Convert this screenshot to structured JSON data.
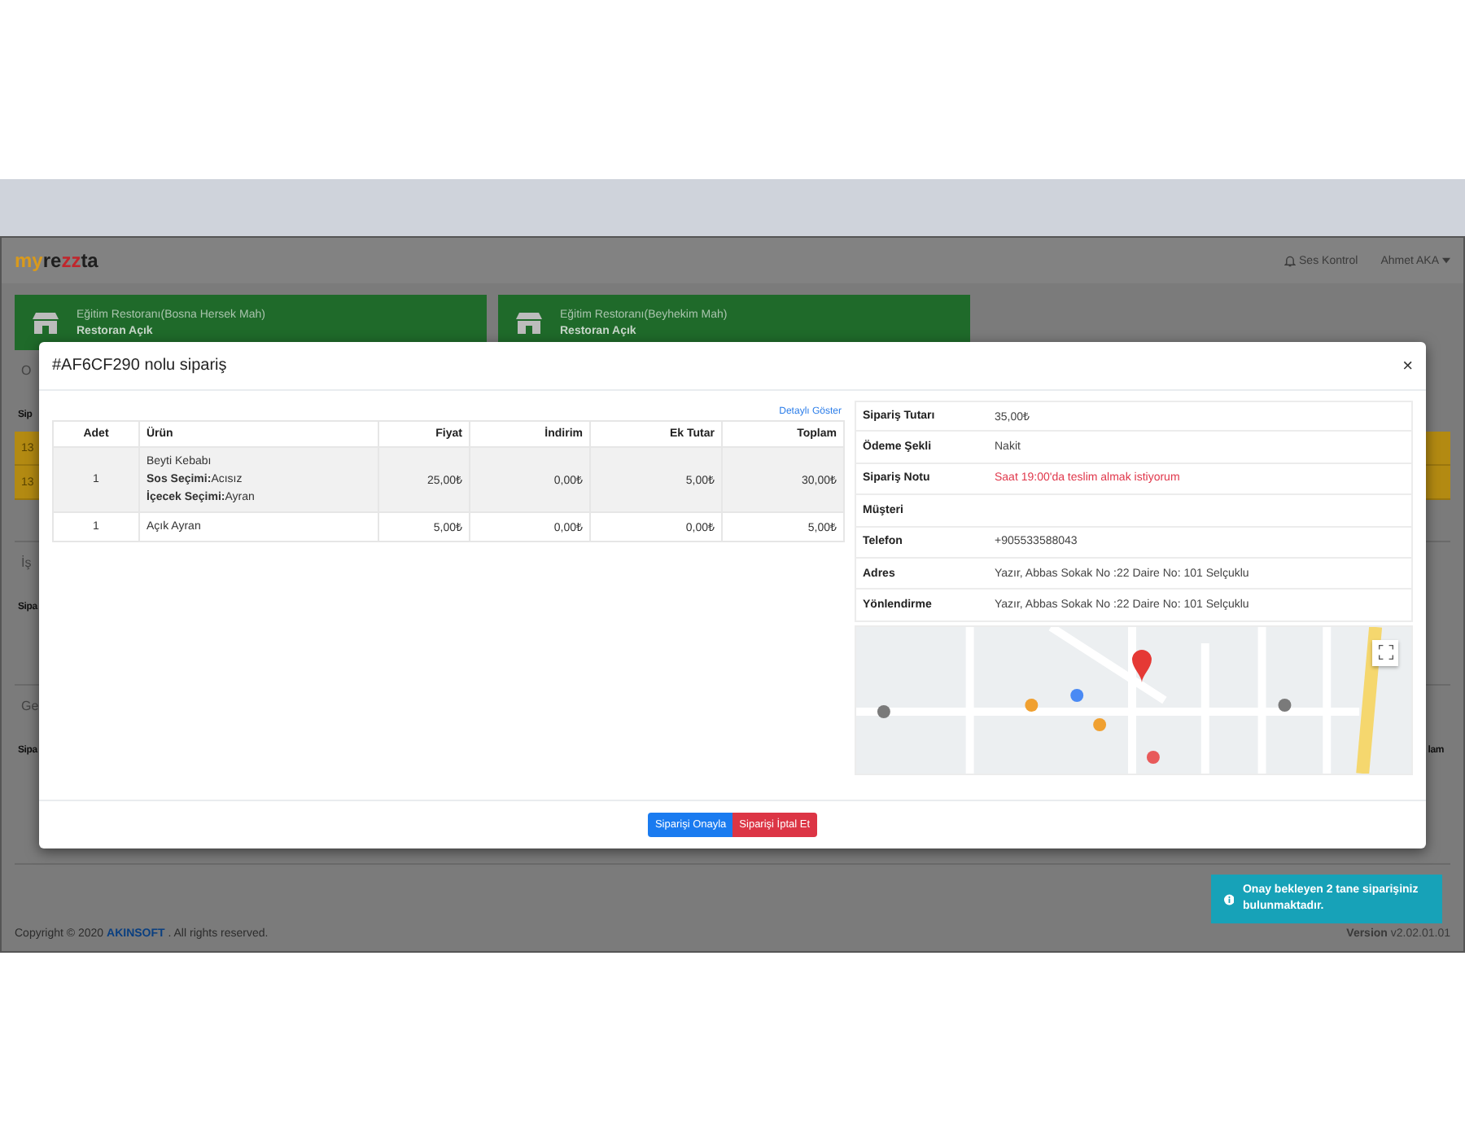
{
  "navbar": {
    "logo": [
      {
        "text": "my",
        "color": "#d99a1c"
      },
      {
        "text": "re",
        "color": "#1e1e1e"
      },
      {
        "text": "zz",
        "color": "#c0262c"
      },
      {
        "text": "ta",
        "color": "#1e1e1e"
      }
    ],
    "sound": "Ses Kontrol",
    "user": "Ahmet AKA"
  },
  "restaurants": [
    {
      "name": "Eğitim Restoranı(Bosna Hersek Mah)",
      "status": "Restoran Açık"
    },
    {
      "name": "Eğitim Restoranı(Beyhekim Mah)",
      "status": "Restoran Açık"
    }
  ],
  "background_sections": [
    {
      "tab": "O",
      "header": "Sip",
      "rows": [
        "13",
        "13"
      ]
    },
    {
      "tab": "İş",
      "header": "Sipa"
    },
    {
      "tab": "Ge",
      "header": "Sipa",
      "header_right": "lam"
    }
  ],
  "modal": {
    "title": "#AF6CF290 nolu sipariş",
    "close": "×",
    "detail_link": "Detaylı Göster",
    "columns": [
      "Adet",
      "Ürün",
      "Fiyat",
      "İndirim",
      "Ek Tutar",
      "Toplam"
    ],
    "rows": [
      {
        "qty": "1",
        "product": [
          "Beyti Kebabı",
          "**Sos Seçimi:**Acısız",
          "**İçecek Seçimi:**Ayran"
        ],
        "price": "25,00₺",
        "discount": "0,00₺",
        "extra": "5,00₺",
        "total": "30,00₺"
      },
      {
        "qty": "1",
        "product": [
          "Açık Ayran"
        ],
        "price": "5,00₺",
        "discount": "0,00₺",
        "extra": "0,00₺",
        "total": "5,00₺"
      }
    ],
    "info": [
      {
        "label": "Sipariş Tutarı",
        "value": "35,00₺",
        "kind": "text"
      },
      {
        "label": "Ödeme Şekli",
        "value": "Nakit",
        "kind": "text"
      },
      {
        "label": "Sipariş Notu",
        "value": "Saat 19:00'da teslim almak istiyorum",
        "kind": "alert"
      },
      {
        "label": "Müşteri",
        "kind": "text"
      },
      {
        "label": "Telefon",
        "value": "+905533588043",
        "kind": "text"
      },
      {
        "label": "Adres",
        "value": "Yazır, Abbas Sokak No :22 Daire No: 101 Selçuklu",
        "kind": "text"
      },
      {
        "label": "Yönlendirme",
        "value": "Yazır, Abbas Sokak No :22 Daire No: 101 Selçuklu",
        "kind": "text"
      }
    ],
    "buttons": [
      {
        "label": "Siparişi Onayla",
        "kind": "primary"
      },
      {
        "label": "Siparişi İptal Et",
        "kind": "danger"
      }
    ]
  },
  "toast": "Onay bekleyen 2 tane siparişiniz bulunmaktadır.",
  "footer": {
    "before": "Copyright © 2020 ",
    "link": "AKINSOFT",
    "after": " . All rights reserved.",
    "version_label": "Version",
    "version": "v2.02.01.01"
  }
}
